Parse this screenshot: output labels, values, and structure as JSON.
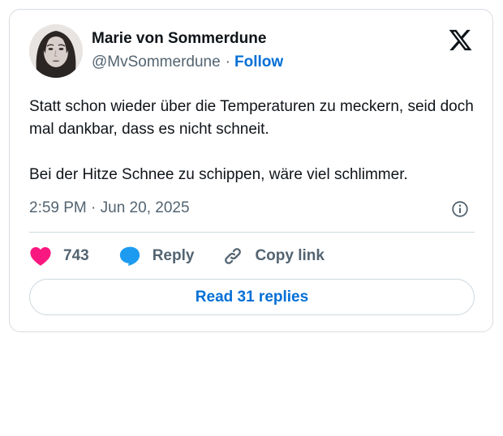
{
  "author": {
    "name": "Marie von Sommerdune",
    "handle": "@MvSommerdune",
    "separator": "·",
    "follow_label": "Follow",
    "avatar_icon": "portrait-photo"
  },
  "brand": {
    "logo_icon": "x-logo-icon"
  },
  "tweet": {
    "paragraphs": [
      "Statt schon wieder über die Temperaturen zu meckern, seid doch mal dankbar, dass es nicht schneit.",
      "Bei der Hitze Schnee zu schippen, wäre viel schlimmer."
    ],
    "timestamp": "2:59 PM · Jun 20, 2025"
  },
  "actions": {
    "likes": "743",
    "reply_label": "Reply",
    "copy_link_label": "Copy link",
    "read_replies_label": "Read 31 replies"
  },
  "colors": {
    "accent": "#006fd6",
    "like": "#f91880",
    "reply": "#1d9bf0",
    "muted_text": "#536471",
    "border": "#cfd9de"
  }
}
